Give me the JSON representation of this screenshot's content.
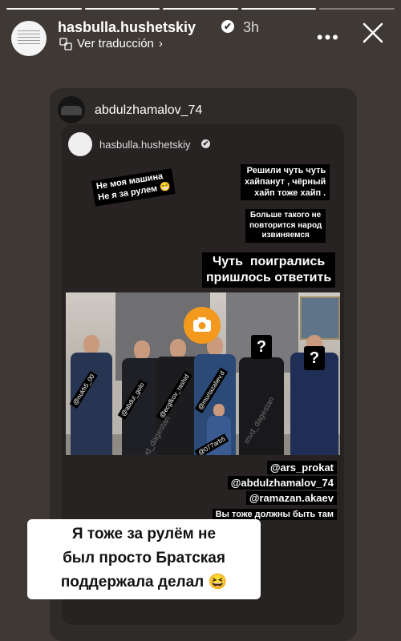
{
  "story": {
    "segments_total": 5,
    "segments_done": 4,
    "username": "hasbulla.hushetskiy",
    "time": "3h",
    "translate_label": "Ver traducción",
    "verified_mark": "✔"
  },
  "shared_post": {
    "username": "abdulzhamalov_74",
    "inner_username": "hasbulla.hushetskiy",
    "sticker_1": "Не моя машина\nНе я за рулем 😁",
    "sticker_2": "Решили чуть чуть\nхайпанут , чёрный\nхайп тоже хайп .",
    "sticker_3": "Больше такого не\nповторится народ\nизвиняемся",
    "sticker_4": "Чуть  поигрались\nпришлось ответить",
    "photo_tags": [
      "@nukh5_00",
      "@abdul_golo",
      "@ecgfkov_rashid",
      "@murtazaliev.d",
      "@077arb5"
    ],
    "question_mark": "?",
    "watermark": "mvd_dagestan",
    "mentions": [
      "@ars_prokat",
      "@abdulzhamalov_74",
      "@ramazan.akaev"
    ],
    "mention_note": "Вы тоже должны быть там"
  },
  "caption": "Я тоже за рулём не\nбыл просто Братская\nподдержала делал 😆",
  "icons": {
    "translate": "translate-icon",
    "more": "more-options-icon",
    "close": "close-icon",
    "camera": "camera-icon"
  },
  "colors": {
    "background": "#3f3935",
    "card": "#2f2b29",
    "camera_button": "#f39a1e"
  }
}
